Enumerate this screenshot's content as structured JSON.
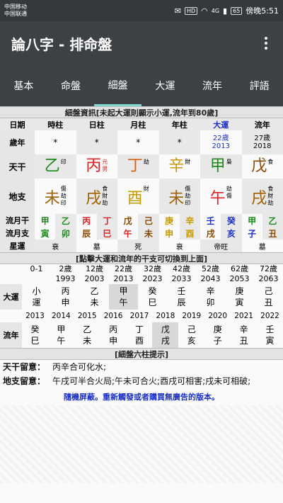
{
  "status": {
    "carrier1": "中国移动",
    "carrier2": "中国联通",
    "time_label": "傍晚5:51",
    "battery": "65",
    "hd": "HD",
    "net": "4G"
  },
  "app": {
    "title": "論八字 - 排命盤"
  },
  "tabs": [
    "基本",
    "命盤",
    "細盤",
    "大運",
    "流年",
    "評語"
  ],
  "detail": {
    "header": "細盤資訊[未起大運則顯示小運,流年到80歲]",
    "cols": [
      "日期",
      "時柱",
      "日柱",
      "月柱",
      "年柱",
      "大運",
      "流年"
    ],
    "age_label": "歲年",
    "age_cells": [
      "*",
      "*",
      "*",
      "*",
      "22歲",
      "27歲"
    ],
    "year_cells": [
      "",
      "",
      "",
      "",
      "2013",
      "2018"
    ],
    "tiangan_label": "天干",
    "tiangan": [
      {
        "c": "乙",
        "s1": "印",
        "s2": "",
        "color": "#1a8a1a"
      },
      {
        "c": "丙",
        "s1": "元",
        "s2": "男",
        "color": "#d22"
      },
      {
        "c": "丁",
        "s1": "劫",
        "s2": "",
        "color": "#e06010"
      },
      {
        "c": "辛",
        "s1": "財",
        "s2": "",
        "color": "#c79a00"
      },
      {
        "c": "甲",
        "s1": "梟",
        "s2": "",
        "color": "#1a8a1a"
      },
      {
        "c": "戊",
        "s1": "食",
        "s2": "",
        "color": "#8a4a00"
      }
    ],
    "dizhi_label": "地支",
    "dizhi": [
      {
        "c": "未",
        "s": [
          "傷",
          "劫",
          "印"
        ],
        "color": "#a06000"
      },
      {
        "c": "戌",
        "s": [
          "食",
          "財",
          "劫"
        ],
        "color": "#a06000"
      },
      {
        "c": "酉",
        "s": [
          "財"
        ],
        "color": "#c79a00"
      },
      {
        "c": "未",
        "s": [
          "傷",
          "劫",
          "印"
        ],
        "color": "#a06000"
      },
      {
        "c": "午",
        "s": [
          "劫",
          "傷"
        ],
        "color": "#d22"
      },
      {
        "c": "戌",
        "s": [
          "食",
          "財",
          "劫"
        ],
        "color": "#a06000"
      }
    ],
    "liuyue_gan_label": "流月干",
    "liuyue_gan": [
      {
        "c": "甲",
        "color": "#1a8a1a"
      },
      {
        "c": "乙",
        "color": "#1a8a1a"
      },
      {
        "c": "丙",
        "color": "#d22"
      },
      {
        "c": "丁",
        "color": "#d22"
      },
      {
        "c": "戊",
        "color": "#8a4a00"
      },
      {
        "c": "己",
        "color": "#8a4a00"
      },
      {
        "c": "庚",
        "color": "#c79a00"
      },
      {
        "c": "辛",
        "color": "#c79a00"
      },
      {
        "c": "壬",
        "color": "#1a2fc4"
      },
      {
        "c": "癸",
        "color": "#1a2fc4"
      },
      {
        "c": "甲",
        "color": "#1a8a1a"
      },
      {
        "c": "乙",
        "color": "#1a8a1a"
      }
    ],
    "liuyue_zhi_label": "流月支",
    "liuyue_zhi": [
      {
        "c": "寅",
        "color": "#1a8a1a"
      },
      {
        "c": "卯",
        "color": "#1a8a1a"
      },
      {
        "c": "辰",
        "color": "#8a4a00"
      },
      {
        "c": "巳",
        "color": "#d22"
      },
      {
        "c": "午",
        "color": "#d22"
      },
      {
        "c": "未",
        "color": "#8a4a00"
      },
      {
        "c": "申",
        "color": "#c79a00"
      },
      {
        "c": "酉",
        "color": "#c79a00"
      },
      {
        "c": "戌",
        "color": "#8a4a00"
      },
      {
        "c": "亥",
        "color": "#1a2fc4"
      },
      {
        "c": "子",
        "color": "#1a2fc4"
      },
      {
        "c": "丑",
        "color": "#8a4a00"
      }
    ],
    "xingyun_label": "星運",
    "xingyun": [
      "衰",
      "墓",
      "死",
      "衰",
      "帝旺",
      "墓"
    ]
  },
  "dayun": {
    "header": "[點擊大運和流年的干支可切換到上面]",
    "ages": [
      "0-1",
      "2歲",
      "12歲",
      "22歲",
      "32歲",
      "42歲",
      "52歲",
      "62歲",
      "72歲"
    ],
    "years": [
      "",
      "1993",
      "2003",
      "2013",
      "2023",
      "2033",
      "2043",
      "2053",
      "2063"
    ],
    "label": "大運",
    "pillars": [
      [
        "小",
        "運"
      ],
      [
        "丙",
        "申"
      ],
      [
        "乙",
        "未"
      ],
      [
        "甲",
        "午"
      ],
      [
        "癸",
        "巳"
      ],
      [
        "壬",
        "辰"
      ],
      [
        "辛",
        "卯"
      ],
      [
        "庚",
        "寅"
      ],
      [
        "己",
        "丑"
      ]
    ]
  },
  "liunian": {
    "years": [
      "2013",
      "2014",
      "2015",
      "2016",
      "2017",
      "2018",
      "2019",
      "2020",
      "2021",
      "2022"
    ],
    "label": "流年",
    "pillars": [
      [
        "癸",
        "巳"
      ],
      [
        "甲",
        "午"
      ],
      [
        "乙",
        "未"
      ],
      [
        "丙",
        "申"
      ],
      [
        "丁",
        "酉"
      ],
      [
        "戊",
        "戌"
      ],
      [
        "己",
        "亥"
      ],
      [
        "庚",
        "子"
      ],
      [
        "辛",
        "丑"
      ],
      [
        "壬",
        "寅"
      ]
    ]
  },
  "notes": {
    "header": "[細盤六柱提示]",
    "tg_label": "天干留意：",
    "tg_text": "丙辛合可化水;",
    "dz_label": "地支留意：",
    "dz_text": "午戌可半合火局;午未可合火;酉戌可相害;戌未可相破;",
    "ad": "隨機屏蔽。重新觸發或者購買無廣告的版本。"
  }
}
